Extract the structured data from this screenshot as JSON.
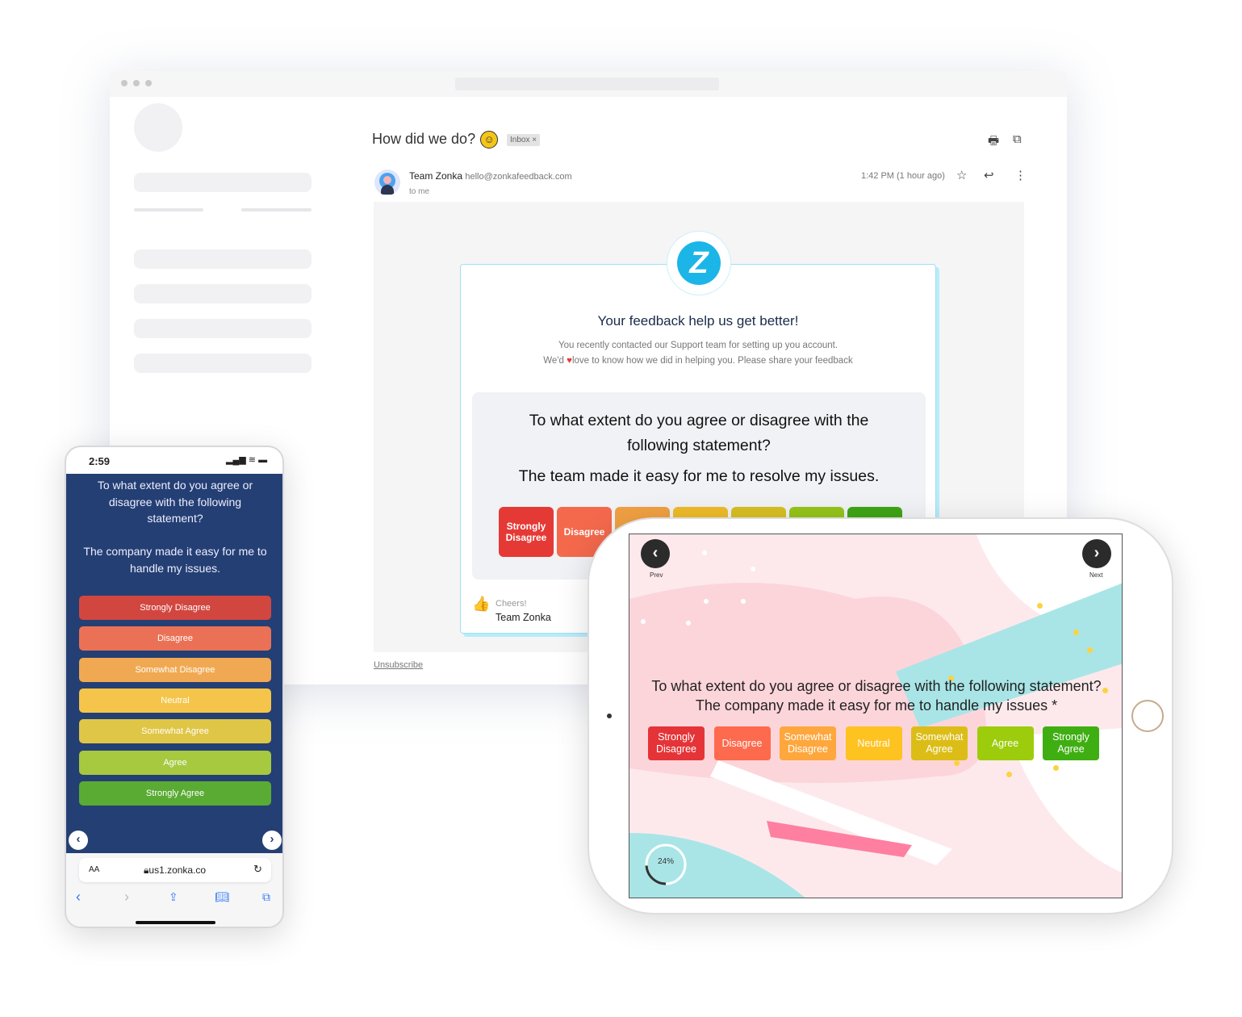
{
  "email": {
    "subject": "How did we do?",
    "subject_emoji": "☺",
    "label": "Inbox ×",
    "sender_name": "Team Zonka",
    "sender_email": "hello@zonkafeedback.com",
    "recipient": "to me",
    "time": "1:42 PM (1 hour ago)",
    "logo_letter": "Z",
    "heading": "Your feedback help us get better!",
    "intro_line1": "You recently contacted our Support team for setting up you account.",
    "intro_line2_a": "We'd",
    "intro_line2_b": "love to know how we did in helping you. Please share your feedback",
    "question_line1": "To what extent do you agree or disagree with the",
    "question_line2": "following statement?",
    "statement": "The team made it easy for me to resolve my issues.",
    "options": [
      {
        "label": "Strongly Disagree",
        "color": "#e53935"
      },
      {
        "label": "Disagree",
        "color": "#f4694c"
      },
      {
        "label": "",
        "color": "#f0a043"
      },
      {
        "label": "",
        "color": "#efbb2a"
      },
      {
        "label": "",
        "color": "#d7bf22"
      },
      {
        "label": "",
        "color": "#96c41a"
      },
      {
        "label": "",
        "color": "#3fa515"
      }
    ],
    "signoff": "Cheers!",
    "signature": "Team Zonka",
    "unsubscribe": "Unsubscribe"
  },
  "tablet": {
    "prev": "Prev",
    "next": "Next",
    "question": "To what extent do you agree or disagree with the following statement? The company made it easy for me to handle my issues *",
    "options": [
      {
        "label": "Strongly Disagree",
        "color": "#e53438"
      },
      {
        "label": "Disagree",
        "color": "#fd6a4d"
      },
      {
        "label": "Somewhat Disagree",
        "color": "#fea73d"
      },
      {
        "label": "Neutral",
        "color": "#fec221"
      },
      {
        "label": "Somewhat Agree",
        "color": "#dcbd17"
      },
      {
        "label": "Agree",
        "color": "#9ccc0c"
      },
      {
        "label": "Strongly Agree",
        "color": "#3fae12"
      }
    ],
    "progress_label": "24%",
    "progress": 24
  },
  "phone": {
    "time": "2:59",
    "question": "To what extent do you agree or disagree with the following statement?",
    "statement": "The company made it easy for me to handle my issues.",
    "options": [
      {
        "label": "Strongly Disagree",
        "color": "#d24640"
      },
      {
        "label": "Disagree",
        "color": "#eb7156"
      },
      {
        "label": "Somewhat Disagree",
        "color": "#f0a952"
      },
      {
        "label": "Neutral",
        "color": "#f4c54a"
      },
      {
        "label": "Somewhat Agree",
        "color": "#dfc646"
      },
      {
        "label": "Agree",
        "color": "#a6c940"
      },
      {
        "label": "Strongly Agree",
        "color": "#5aab33"
      }
    ],
    "text_size": "AA",
    "url": "us1.zonka.co"
  }
}
